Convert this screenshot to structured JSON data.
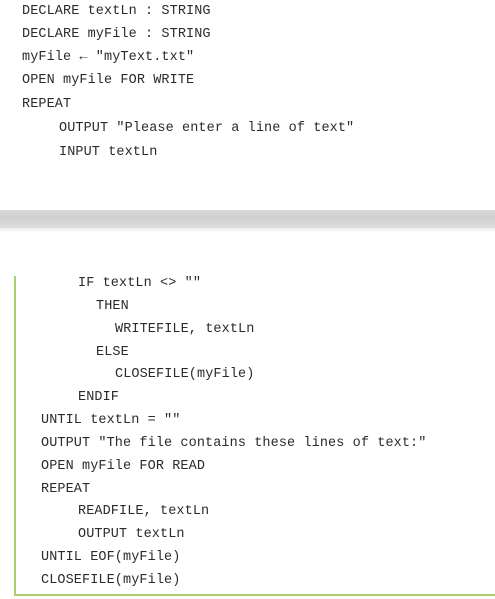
{
  "top_block": {
    "lines": [
      "DECLARE textLn : STRING",
      "DECLARE myFile : STRING",
      "myFile ← \"myText.txt\"",
      "OPEN myFile FOR WRITE",
      "REPEAT",
      "OUTPUT \"Please enter a line of text\"",
      "INPUT textLn"
    ]
  },
  "bottom_block": {
    "lines": [
      "IF textLn <> \"\"",
      "THEN",
      "WRITEFILE, textLn",
      "ELSE",
      "CLOSEFILE(myFile)",
      "ENDIF",
      "UNTIL textLn = \"\"",
      "OUTPUT \"The file contains these lines of text:\"",
      "OPEN myFile FOR READ",
      "REPEAT",
      "READFILE, textLn",
      "OUTPUT textLn",
      "UNTIL EOF(myFile)",
      "CLOSEFILE(myFile)"
    ]
  },
  "colors": {
    "box_border": "#a9cf6e",
    "separator": "#d6d6d6",
    "text": "#2b2b2b"
  }
}
